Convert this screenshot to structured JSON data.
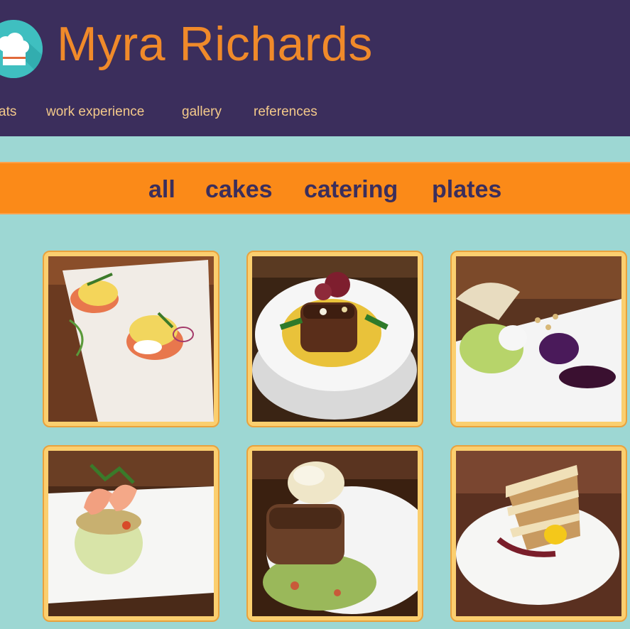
{
  "header": {
    "title": "Myra Richards",
    "nav": [
      {
        "label": "ats"
      },
      {
        "label": "work experience"
      },
      {
        "label": "gallery"
      },
      {
        "label": "references"
      }
    ]
  },
  "filters": [
    {
      "label": "all"
    },
    {
      "label": "cakes"
    },
    {
      "label": "catering"
    },
    {
      "label": "plates"
    }
  ],
  "gallery": [
    {
      "icon": "eggs-benedict-photo"
    },
    {
      "icon": "short-rib-polenta-photo"
    },
    {
      "icon": "frisee-salad-berry-photo"
    },
    {
      "icon": "shrimp-cucumber-tower-photo"
    },
    {
      "icon": "pork-slaw-photo"
    },
    {
      "icon": "layer-cake-slice-photo"
    }
  ],
  "colors": {
    "header_bg": "#3b2e5c",
    "title": "#f08a2a",
    "nav_text": "#f3c98a",
    "page_bg": "#9dd7d3",
    "filter_bg": "#fb8a18",
    "filter_text": "#3b2e5c",
    "tile_frame": "#fbcf6f"
  }
}
